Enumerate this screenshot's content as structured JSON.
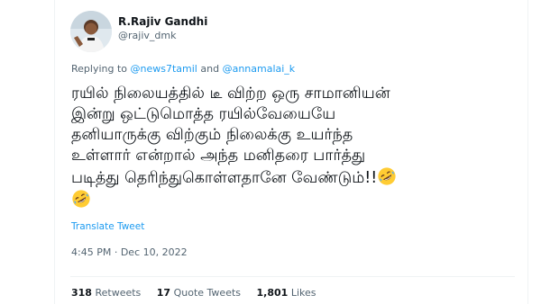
{
  "tweet": {
    "author_name": "R.Rajiv Gandhi",
    "author_handle": "@rajiv_dmk",
    "replying_prefix": "Replying to",
    "reply_mention_1": "@news7tamil",
    "reply_and": "and",
    "reply_mention_2": "@annamalai_k",
    "text_lines": [
      "ரயில் நிலையத்தில் டீ விற்ற ஒரு சாமானியன்",
      "இன்று ஒட்டுமொத்த ரயில்வேயையே",
      "தனியாருக்கு விற்கும் நிலைக்கு உயர்ந்த",
      "உள்ளார் என்றால் அந்த மனிதரை பார்த்து",
      "படித்து தெரிந்துகொள்ளதானே வேண்டும்!!"
    ],
    "emoji": "rolling-on-floor-laughing-emoji",
    "translate_label": "Translate Tweet",
    "time": "4:45 PM",
    "separator": "·",
    "date": "Dec 10, 2022"
  },
  "stats": {
    "retweets_count": "318",
    "retweets_label": "Retweets",
    "quotes_count": "17",
    "quotes_label": "Quote Tweets",
    "likes_count": "1,801",
    "likes_label": "Likes"
  },
  "colors": {
    "link": "#1d9bf0",
    "secondary_text": "#536471",
    "primary_text": "#0f1419",
    "divider": "#eff3f4"
  }
}
